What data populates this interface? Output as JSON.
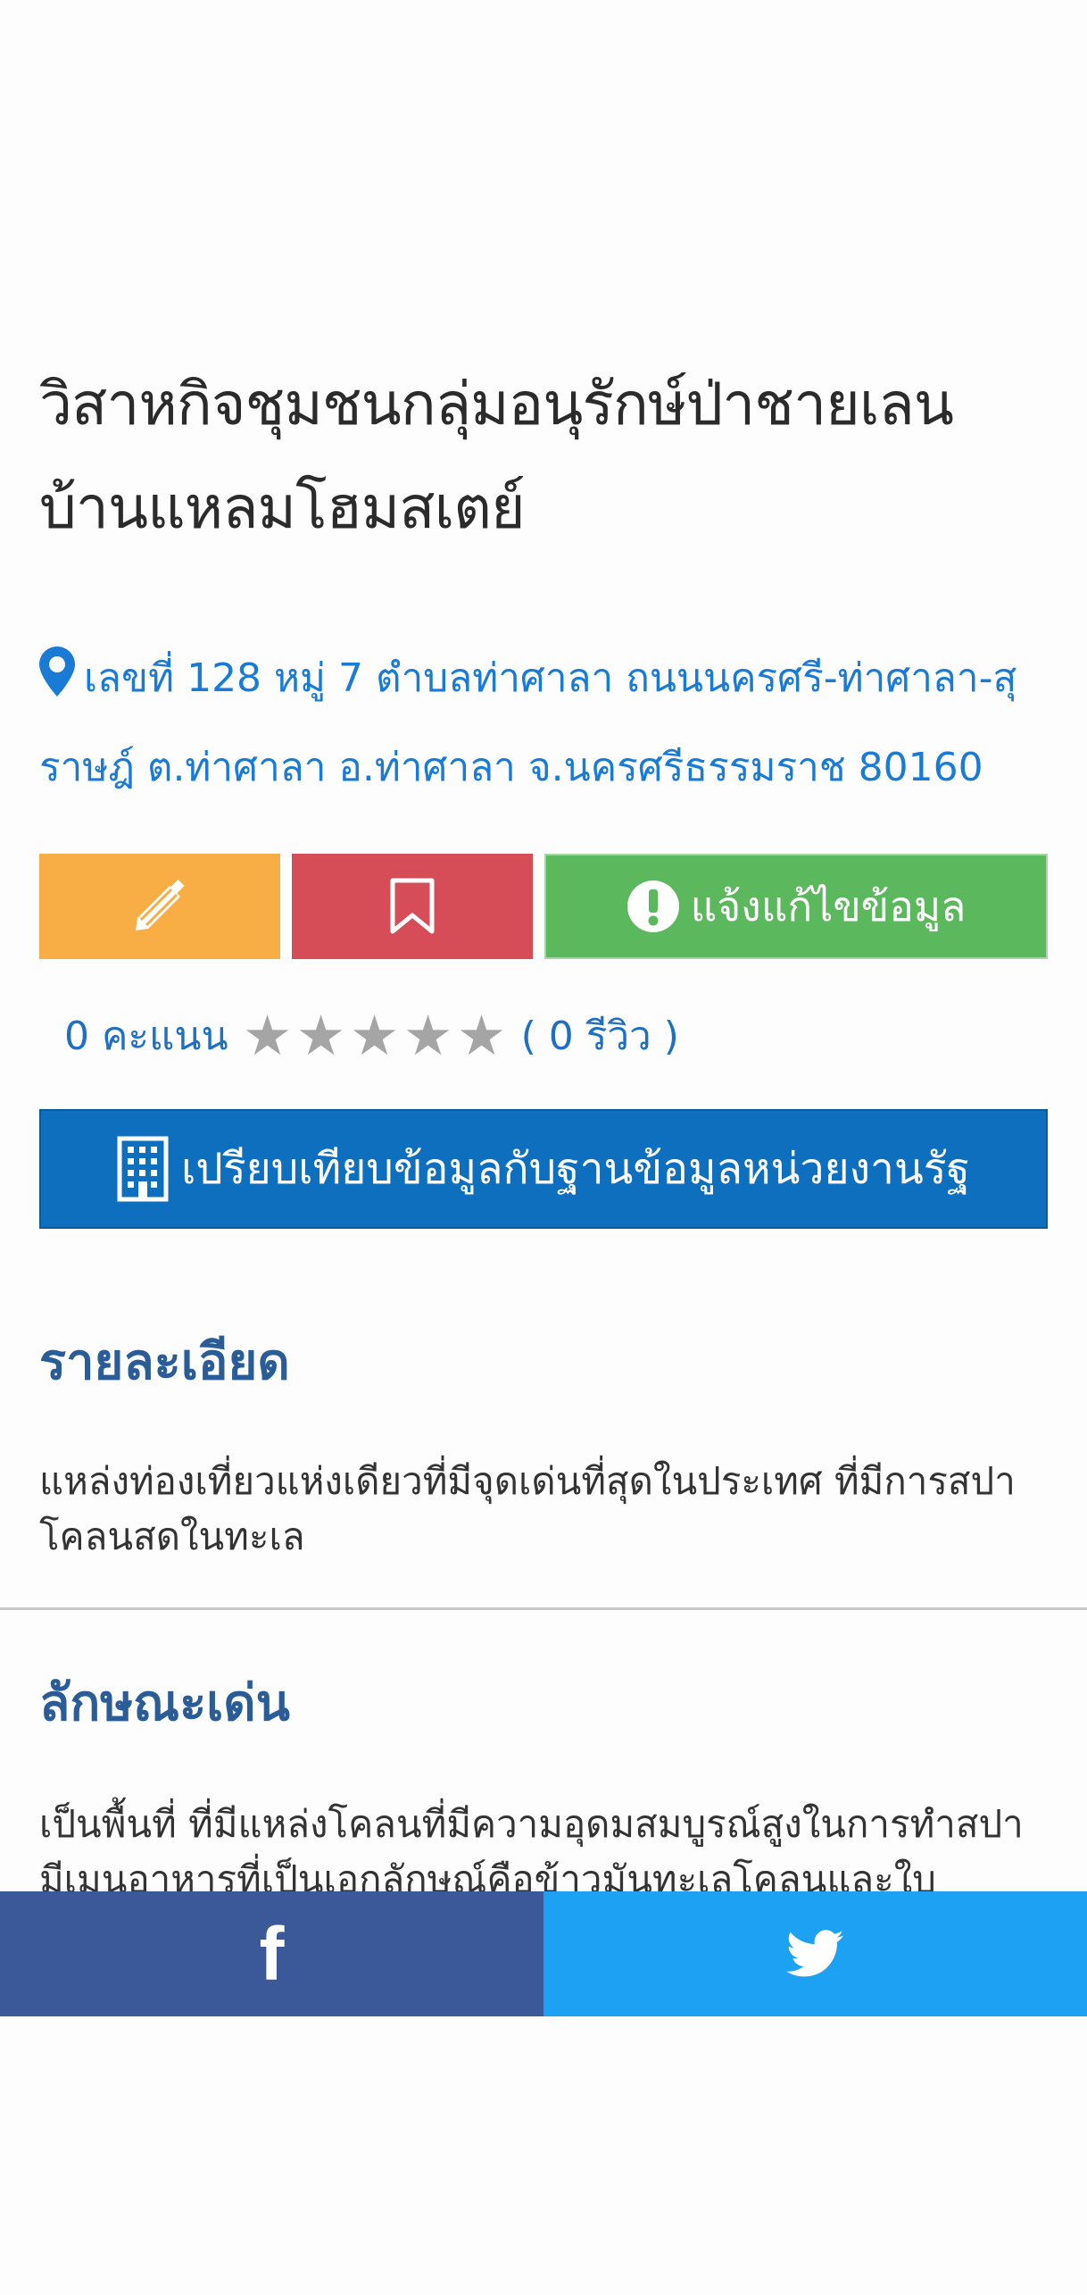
{
  "listing": {
    "title": "วิสาหกิจชุมชนกลุ่มอนุรักษ์ป่าชายเลนบ้านแหลมโฮมสเตย์",
    "address": "เลขที่ 128 หมู่ 7 ตำบลท่าศาลา ถนนนครศรี-ท่าศาลา-สุราษฎ์ ต.ท่าศาลา อ.ท่าศาลา จ.นครศรีธรรมราช 80160"
  },
  "actions": {
    "edit_icon": "pencil-icon",
    "save_icon": "bookmark-icon",
    "report_icon": "exclamation-circle-icon",
    "report_label": "แจ้งแก้ไขข้อมูล",
    "colors": {
      "edit": "#f9ae45",
      "save": "#d64d58",
      "report": "#5cb85c"
    }
  },
  "rating": {
    "score_text": "0 คะแนน",
    "stars_total": 5,
    "stars_filled": 0,
    "reviews_text": "( 0 รีวิว )"
  },
  "compare": {
    "icon": "building-icon",
    "label": "เปรียบเทียบข้อมูลกับฐานข้อมูลหน่วยงานรัฐ"
  },
  "details": {
    "heading": "รายละเอียด",
    "text": "แหล่งท่องเที่ยวแห่งเดียวที่มีจุดเด่นที่สุดในประเทศ ที่มีการสปาโคลนสดในทะเล"
  },
  "highlights": {
    "heading": "ลักษณะเด่น",
    "text": "เป็นพื้นที่ ที่มีแหล่งโคลนที่มีความอุดมสมบูรณ์สูงในการทำสปา มีเมนูอาหารที่เป็นเอกลักษณ์คือข้าวมันทะเลโคลนและใบ"
  },
  "share": {
    "facebook_icon": "facebook-icon",
    "twitter_icon": "twitter-icon",
    "facebook_color": "#3b5998",
    "twitter_color": "#1da1f2"
  }
}
